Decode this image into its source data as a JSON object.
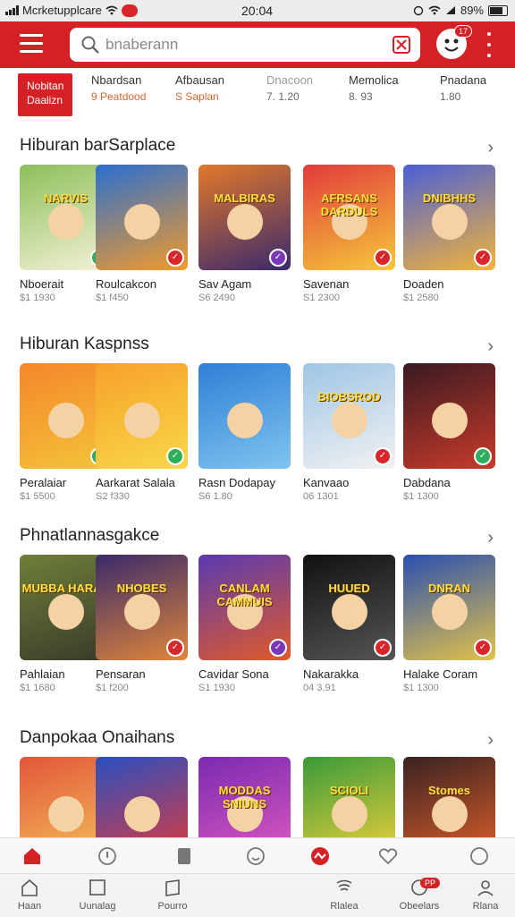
{
  "status": {
    "carrier": "Mcrketupplcare",
    "time": "20:04",
    "battery": "89%"
  },
  "search": {
    "placeholder": "bnaberann"
  },
  "avatar": {
    "badge": "17"
  },
  "categories": [
    {
      "line1": "Nobitan",
      "line2": "Daalizn",
      "active": true
    },
    {
      "line1": "Nbardsan",
      "line2": "9 Peatdood"
    },
    {
      "line1": "Afbausan",
      "line2": "S  Saplan"
    },
    {
      "line1": "Dnacoon",
      "line2": "7. 1.20"
    },
    {
      "line1": "Memolica",
      "line2": "8. 93"
    },
    {
      "line1": "Pnadana",
      "line2": "1.80"
    }
  ],
  "sections": [
    {
      "title": "Hiburan barSarplace",
      "items": [
        {
          "art": "NARVIS",
          "name": "Nboerait",
          "meta": "$1 1930",
          "check": "green",
          "bg": "#8dbf5a",
          "bg2": "#f4f1d7"
        },
        {
          "art": "",
          "name": "Roulcakcon",
          "meta": "$1 f450",
          "check": "red",
          "bg": "#2a6fd0",
          "bg2": "#f39a2a"
        },
        {
          "art": "MALBIRAS",
          "name": "Sav Agam",
          "meta": "S6 2490",
          "check": "purple",
          "bg": "#e2782b",
          "bg2": "#3a2a6c"
        },
        {
          "art": "AFRSANS DARDULS",
          "name": "Savenan",
          "meta": "S1 2300",
          "check": "red",
          "bg": "#e23b3b",
          "bg2": "#f5c83a"
        },
        {
          "art": "DNIBHHS",
          "name": "Doaden",
          "meta": "$1 2580",
          "check": "red",
          "bg": "#4a5fd6",
          "bg2": "#f2b43a"
        }
      ]
    },
    {
      "title": "Hiburan Kaspnss",
      "items": [
        {
          "art": "",
          "name": "Peralaiar",
          "meta": "$1 5500",
          "check": "green",
          "bg": "#f5862a",
          "bg2": "#f3c43a"
        },
        {
          "art": "",
          "name": "Aarkarat Salala",
          "meta": "S2 f330",
          "check": "green",
          "bg": "#f7a12a",
          "bg2": "#f8d74a"
        },
        {
          "art": "",
          "name": "Rasn Dodapay",
          "meta": "S6 1.80",
          "check": "",
          "bg": "#2f7fd6",
          "bg2": "#7fc4ef"
        },
        {
          "art": "BIOBSROD",
          "name": "Kanvaao",
          "meta": "06 1301",
          "check": "red",
          "bg": "#9fc5e5",
          "bg2": "#f2f2f2"
        },
        {
          "art": "",
          "name": "Dabdana",
          "meta": "$1 1300",
          "check": "green",
          "bg": "#3a1a22",
          "bg2": "#c83a2a"
        }
      ]
    },
    {
      "title": "Phnatlannasgakce",
      "items": [
        {
          "art": "MUBBA HARAS",
          "name": "Pahlaian",
          "meta": "$1 1680",
          "check": "",
          "bg": "#6f7f3a",
          "bg2": "#3a3a2a"
        },
        {
          "art": "NHOBES",
          "name": "Pensaran",
          "meta": "$1 f200",
          "check": "red",
          "bg": "#3a2a6a",
          "bg2": "#e0863a"
        },
        {
          "art": "CANLAM CAMMUIS",
          "name": "Cavidar Sona",
          "meta": "S1 1930",
          "check": "purple",
          "bg": "#5a3ab0",
          "bg2": "#e05a2a"
        },
        {
          "art": "HUUED",
          "name": "Nakarakka",
          "meta": "04 3.91",
          "check": "red",
          "bg": "#111111",
          "bg2": "#555555"
        },
        {
          "art": "DNRAN",
          "name": "Halake Coram",
          "meta": "$1 1300",
          "check": "red",
          "bg": "#2a4fb0",
          "bg2": "#e2c24a"
        }
      ]
    },
    {
      "title": "Danpokaa Onaihans",
      "items": [
        {
          "art": "",
          "name": "",
          "meta": "",
          "check": "",
          "bg": "#e2563a",
          "bg2": "#f4c15a"
        },
        {
          "art": "",
          "name": "",
          "meta": "",
          "check": "",
          "bg": "#2a4fc0",
          "bg2": "#e23a3a"
        },
        {
          "art": "MODDAS SNIUNS",
          "name": "",
          "meta": "",
          "check": "",
          "bg": "#7a2ab0",
          "bg2": "#e05ac0"
        },
        {
          "art": "SCIOLI",
          "name": "",
          "meta": "",
          "check": "",
          "bg": "#3a9a3a",
          "bg2": "#f2d23a"
        },
        {
          "art": "Stomes",
          "name": "",
          "meta": "",
          "check": "",
          "bg": "#3a2222",
          "bg2": "#e0602a"
        }
      ]
    }
  ],
  "bottom_nav": [
    {
      "label": "Haan"
    },
    {
      "label": "Uunalag"
    },
    {
      "label": "Pourro"
    },
    {
      "label": "Rlalea"
    },
    {
      "label": "Obeelars",
      "badge": "PP"
    },
    {
      "label": "Rlana"
    }
  ]
}
